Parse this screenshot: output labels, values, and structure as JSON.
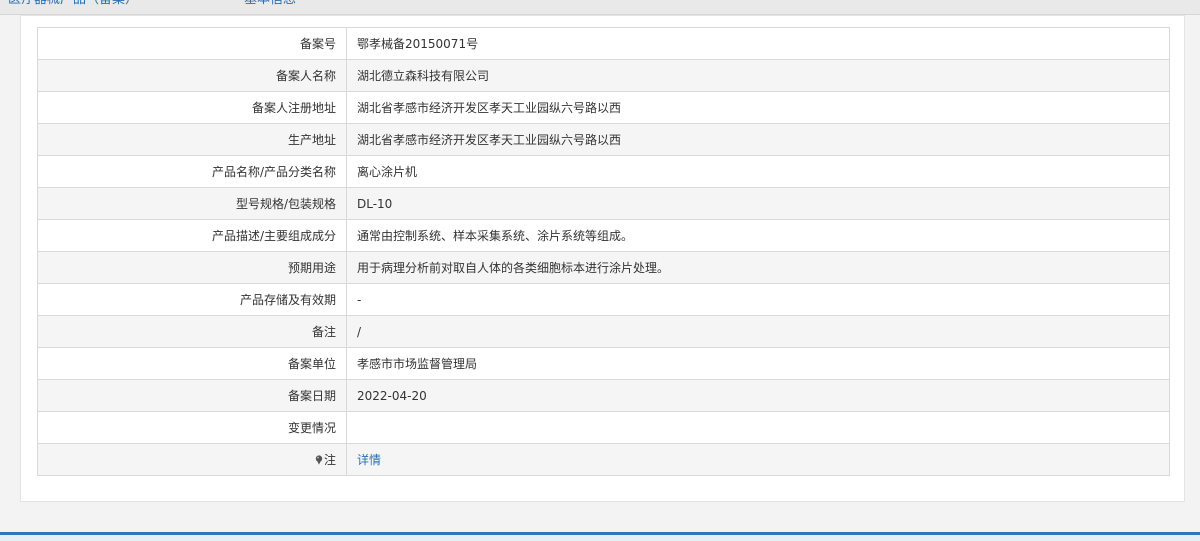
{
  "breadcrumb": {
    "category": "医疗器械产品（备案）",
    "current": "基本信息"
  },
  "rows": [
    {
      "label": "备案号",
      "value": "鄂孝械备20150071号"
    },
    {
      "label": "备案人名称",
      "value": "湖北德立森科技有限公司"
    },
    {
      "label": "备案人注册地址",
      "value": "湖北省孝感市经济开发区孝天工业园纵六号路以西"
    },
    {
      "label": "生产地址",
      "value": "湖北省孝感市经济开发区孝天工业园纵六号路以西"
    },
    {
      "label": "产品名称/产品分类名称",
      "value": "离心涂片机"
    },
    {
      "label": "型号规格/包装规格",
      "value": "DL-10"
    },
    {
      "label": "产品描述/主要组成成分",
      "value": "通常由控制系统、样本采集系统、涂片系统等组成。"
    },
    {
      "label": "预期用途",
      "value": "用于病理分析前对取自人体的各类细胞标本进行涂片处理。"
    },
    {
      "label": "产品存储及有效期",
      "value": "-"
    },
    {
      "label": "备注",
      "value": "/"
    },
    {
      "label": "备案单位",
      "value": "孝感市市场监督管理局"
    },
    {
      "label": "备案日期",
      "value": "2022-04-20"
    },
    {
      "label": "变更情况",
      "value": ""
    },
    {
      "label": "注",
      "value": "详情",
      "icon": "pin-icon"
    }
  ],
  "colors": {
    "link": "#2a6fb0",
    "stripe": "#f5f5f5",
    "border": "#d9d9d9",
    "footer_accent": "#2f78b7"
  }
}
